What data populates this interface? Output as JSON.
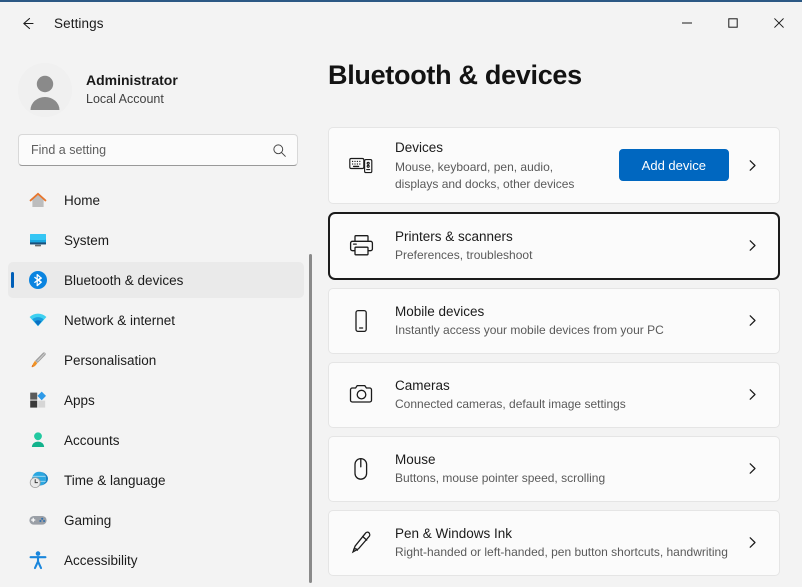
{
  "titlebar": {
    "back_label": "back-arrow",
    "title": "Settings",
    "minimize_label": "Minimise",
    "maximize_label": "Maximise",
    "close_label": "Close"
  },
  "account": {
    "name": "Administrator",
    "subtitle": "Local Account",
    "avatar_icon": "person-avatar-icon"
  },
  "search": {
    "placeholder": "Find a setting",
    "value": "",
    "icon": "search-icon"
  },
  "sidebar": {
    "items": [
      {
        "label": "Home",
        "icon": "home-icon",
        "selected": false
      },
      {
        "label": "System",
        "icon": "system-monitor-icon",
        "selected": false
      },
      {
        "label": "Bluetooth & devices",
        "icon": "bluetooth-icon",
        "selected": true
      },
      {
        "label": "Network & internet",
        "icon": "wifi-icon",
        "selected": false
      },
      {
        "label": "Personalisation",
        "icon": "paintbrush-icon",
        "selected": false
      },
      {
        "label": "Apps",
        "icon": "apps-squares-icon",
        "selected": false
      },
      {
        "label": "Accounts",
        "icon": "person-icon",
        "selected": false
      },
      {
        "label": "Time & language",
        "icon": "globe-clock-icon",
        "selected": false
      },
      {
        "label": "Gaming",
        "icon": "gamepad-icon",
        "selected": false
      },
      {
        "label": "Accessibility",
        "icon": "accessibility-icon",
        "selected": false
      }
    ]
  },
  "main": {
    "page_title": "Bluetooth & devices",
    "cards": [
      {
        "title": "Devices",
        "subtitle": "Mouse, keyboard, pen, audio,\ndisplays and docks, other devices",
        "icon": "devices-keyboard-icon",
        "action_label": "Add device",
        "focused": false
      },
      {
        "title": "Printers & scanners",
        "subtitle": "Preferences, troubleshoot",
        "icon": "printer-icon",
        "action_label": null,
        "focused": true
      },
      {
        "title": "Mobile devices",
        "subtitle": "Instantly access your mobile devices from your PC",
        "icon": "phone-icon",
        "action_label": null,
        "focused": false
      },
      {
        "title": "Cameras",
        "subtitle": "Connected cameras, default image settings",
        "icon": "camera-icon",
        "action_label": null,
        "focused": false
      },
      {
        "title": "Mouse",
        "subtitle": "Buttons, mouse pointer speed, scrolling",
        "icon": "mouse-icon",
        "action_label": null,
        "focused": false
      },
      {
        "title": "Pen & Windows Ink",
        "subtitle": "Right-handed or left-handed, pen button shortcuts, handwriting",
        "icon": "pen-icon",
        "action_label": null,
        "focused": false
      }
    ]
  },
  "colors": {
    "accent": "#0067c0",
    "selection_indicator": "#005fb8",
    "window_background": "#f3f3f3",
    "card_background": "#fbfbfb",
    "focus_ring": "#1b1b1b"
  }
}
